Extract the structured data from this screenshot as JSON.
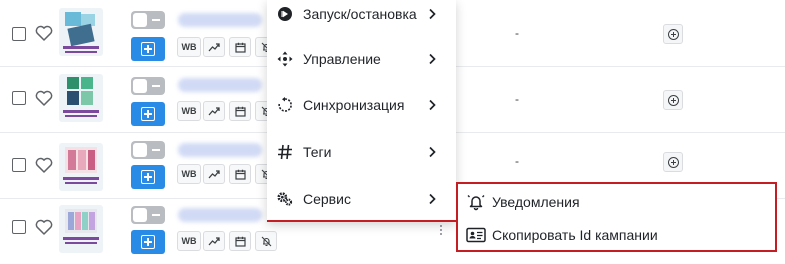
{
  "rows": [
    {
      "marker": "-",
      "wb_label": "WB"
    },
    {
      "marker": "-",
      "wb_label": "WB"
    },
    {
      "marker": "-",
      "wb_label": "WB"
    },
    {
      "marker": "",
      "wb_label": "WB"
    }
  ],
  "context_menu": {
    "items": [
      {
        "label": "Запуск/остановка",
        "icon": "play-circle-icon"
      },
      {
        "label": "Управление",
        "icon": "move-arrows-icon"
      },
      {
        "label": "Синхронизация",
        "icon": "sync-icon"
      },
      {
        "label": "Теги",
        "icon": "hash-icon"
      },
      {
        "label": "Сервис",
        "icon": "gears-icon"
      }
    ]
  },
  "submenu": {
    "items": [
      {
        "label": "Уведомления",
        "icon": "bell-icon"
      },
      {
        "label": "Скопировать Id кампании",
        "icon": "id-card-icon"
      }
    ]
  },
  "colors": {
    "accent_blue": "#2a8be6",
    "highlight_red": "#c21e24",
    "toggle_off": "#b9bcc1"
  }
}
